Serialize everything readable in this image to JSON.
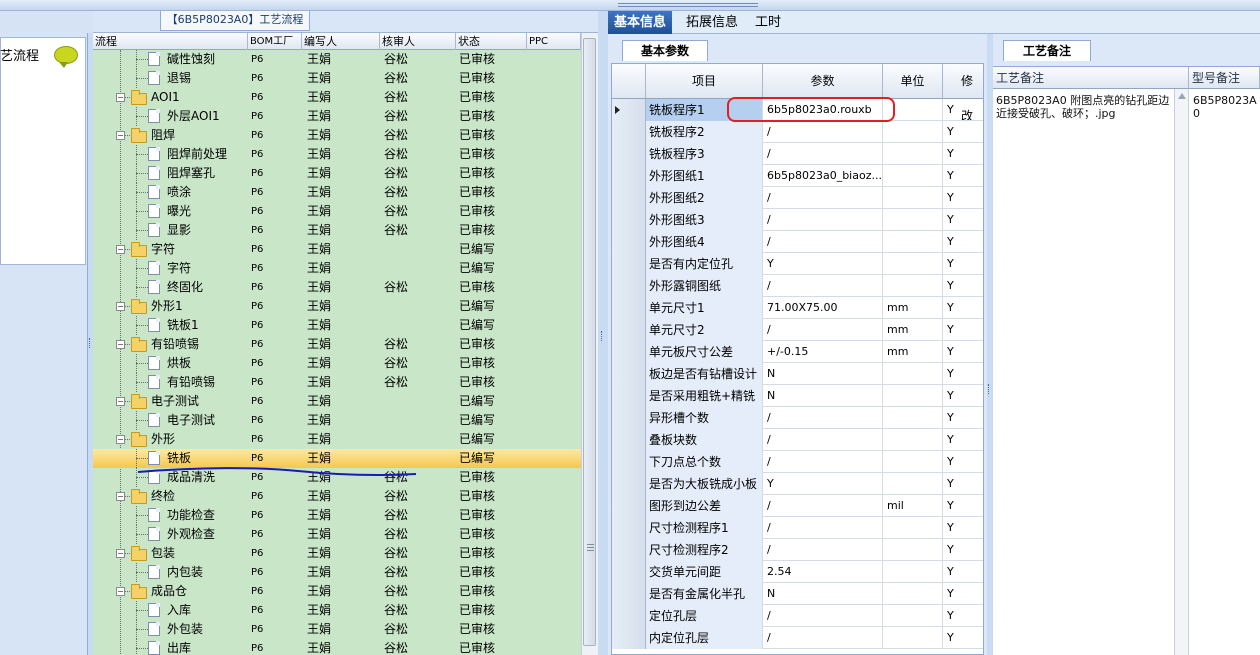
{
  "window": {
    "title_tab": "【6B5P8023A0】工艺流程"
  },
  "left_panel": {
    "flow_label": "艺流程"
  },
  "tree_grid": {
    "columns": [
      "流程",
      "BOM工厂",
      "编写人",
      "核审人",
      "状态",
      "PPC"
    ],
    "rows": [
      {
        "level": 1,
        "type": "doc",
        "name": "碱性蚀刻",
        "bom": "P6",
        "writer": "王娟",
        "reviewer": "谷松",
        "status": "已审核"
      },
      {
        "level": 1,
        "type": "doc",
        "name": "退锡",
        "bom": "P6",
        "writer": "王娟",
        "reviewer": "谷松",
        "status": "已审核"
      },
      {
        "level": 0,
        "type": "folder",
        "name": "AOI1",
        "bom": "P6",
        "writer": "王娟",
        "reviewer": "谷松",
        "status": "已审核"
      },
      {
        "level": 1,
        "type": "doc",
        "name": "外层AOI1",
        "bom": "P6",
        "writer": "王娟",
        "reviewer": "谷松",
        "status": "已审核"
      },
      {
        "level": 0,
        "type": "folder",
        "name": "阻焊",
        "bom": "P6",
        "writer": "王娟",
        "reviewer": "谷松",
        "status": "已审核"
      },
      {
        "level": 1,
        "type": "doc",
        "name": "阻焊前处理",
        "bom": "P6",
        "writer": "王娟",
        "reviewer": "谷松",
        "status": "已审核"
      },
      {
        "level": 1,
        "type": "doc",
        "name": "阻焊塞孔",
        "bom": "P6",
        "writer": "王娟",
        "reviewer": "谷松",
        "status": "已审核"
      },
      {
        "level": 1,
        "type": "doc",
        "name": "喷涂",
        "bom": "P6",
        "writer": "王娟",
        "reviewer": "谷松",
        "status": "已审核"
      },
      {
        "level": 1,
        "type": "doc",
        "name": "曝光",
        "bom": "P6",
        "writer": "王娟",
        "reviewer": "谷松",
        "status": "已审核"
      },
      {
        "level": 1,
        "type": "doc",
        "name": "显影",
        "bom": "P6",
        "writer": "王娟",
        "reviewer": "谷松",
        "status": "已审核"
      },
      {
        "level": 0,
        "type": "folder",
        "name": "字符",
        "bom": "P6",
        "writer": "王娟",
        "reviewer": "",
        "status": "已编写"
      },
      {
        "level": 1,
        "type": "doc",
        "name": "字符",
        "bom": "P6",
        "writer": "王娟",
        "reviewer": "",
        "status": "已编写"
      },
      {
        "level": 1,
        "type": "doc",
        "name": "终固化",
        "bom": "P6",
        "writer": "王娟",
        "reviewer": "谷松",
        "status": "已审核"
      },
      {
        "level": 0,
        "type": "folder",
        "name": "外形1",
        "bom": "P6",
        "writer": "王娟",
        "reviewer": "",
        "status": "已编写"
      },
      {
        "level": 1,
        "type": "doc",
        "name": "铣板1",
        "bom": "P6",
        "writer": "王娟",
        "reviewer": "",
        "status": "已编写"
      },
      {
        "level": 0,
        "type": "folder",
        "name": "有铅喷锡",
        "bom": "P6",
        "writer": "王娟",
        "reviewer": "谷松",
        "status": "已审核"
      },
      {
        "level": 1,
        "type": "doc",
        "name": "烘板",
        "bom": "P6",
        "writer": "王娟",
        "reviewer": "谷松",
        "status": "已审核"
      },
      {
        "level": 1,
        "type": "doc",
        "name": "有铅喷锡",
        "bom": "P6",
        "writer": "王娟",
        "reviewer": "谷松",
        "status": "已审核"
      },
      {
        "level": 0,
        "type": "folder",
        "name": "电子测试",
        "bom": "P6",
        "writer": "王娟",
        "reviewer": "",
        "status": "已编写"
      },
      {
        "level": 1,
        "type": "doc",
        "name": "电子测试",
        "bom": "P6",
        "writer": "王娟",
        "reviewer": "",
        "status": "已编写"
      },
      {
        "level": 0,
        "type": "folder",
        "name": "外形",
        "bom": "P6",
        "writer": "王娟",
        "reviewer": "",
        "status": "已编写"
      },
      {
        "level": 1,
        "type": "doc",
        "name": "铣板",
        "bom": "P6",
        "writer": "王娟",
        "reviewer": "",
        "status": "已编写",
        "selected": true
      },
      {
        "level": 1,
        "type": "doc",
        "name": "成品清洗",
        "bom": "P6",
        "writer": "王娟",
        "reviewer": "谷松",
        "status": "已审核"
      },
      {
        "level": 0,
        "type": "folder",
        "name": "终检",
        "bom": "P6",
        "writer": "王娟",
        "reviewer": "谷松",
        "status": "已审核"
      },
      {
        "level": 1,
        "type": "doc",
        "name": "功能检查",
        "bom": "P6",
        "writer": "王娟",
        "reviewer": "谷松",
        "status": "已审核"
      },
      {
        "level": 1,
        "type": "doc",
        "name": "外观检查",
        "bom": "P6",
        "writer": "王娟",
        "reviewer": "谷松",
        "status": "已审核"
      },
      {
        "level": 0,
        "type": "folder",
        "name": "包装",
        "bom": "P6",
        "writer": "王娟",
        "reviewer": "谷松",
        "status": "已审核"
      },
      {
        "level": 1,
        "type": "doc",
        "name": "内包装",
        "bom": "P6",
        "writer": "王娟",
        "reviewer": "谷松",
        "status": "已审核"
      },
      {
        "level": 0,
        "type": "folder",
        "name": "成品仓",
        "bom": "P6",
        "writer": "王娟",
        "reviewer": "谷松",
        "status": "已审核"
      },
      {
        "level": 1,
        "type": "doc",
        "name": "入库",
        "bom": "P6",
        "writer": "王娟",
        "reviewer": "谷松",
        "status": "已审核"
      },
      {
        "level": 1,
        "type": "doc",
        "name": "外包装",
        "bom": "P6",
        "writer": "王娟",
        "reviewer": "谷松",
        "status": "已审核"
      },
      {
        "level": 1,
        "type": "doc",
        "name": "出库",
        "bom": "P6",
        "writer": "王娟",
        "reviewer": "谷松",
        "status": "已审核"
      }
    ]
  },
  "right_tabs": [
    "基本信息",
    "拓展信息",
    "工时"
  ],
  "basic_params": {
    "tab_label": "基本参数",
    "columns": [
      "项目",
      "参数",
      "单位",
      "修改"
    ],
    "rows": [
      {
        "item": "铣板程序1",
        "value": "6b5p8023a0.rouxb",
        "unit": "",
        "mod": "Y",
        "current": true
      },
      {
        "item": "铣板程序2",
        "value": "/",
        "unit": "",
        "mod": "Y"
      },
      {
        "item": "铣板程序3",
        "value": "/",
        "unit": "",
        "mod": "Y"
      },
      {
        "item": "外形图纸1",
        "value": "6b5p8023a0_biaoz...",
        "unit": "",
        "mod": "Y"
      },
      {
        "item": "外形图纸2",
        "value": "/",
        "unit": "",
        "mod": "Y"
      },
      {
        "item": "外形图纸3",
        "value": "/",
        "unit": "",
        "mod": "Y"
      },
      {
        "item": "外形图纸4",
        "value": "/",
        "unit": "",
        "mod": "Y"
      },
      {
        "item": "是否有内定位孔",
        "value": "Y",
        "unit": "",
        "mod": "Y"
      },
      {
        "item": "外形露铜图纸",
        "value": "/",
        "unit": "",
        "mod": "Y"
      },
      {
        "item": "单元尺寸1",
        "value": "71.00X75.00",
        "unit": "mm",
        "mod": "Y"
      },
      {
        "item": "单元尺寸2",
        "value": "/",
        "unit": "mm",
        "mod": "Y"
      },
      {
        "item": "单元板尺寸公差",
        "value": "+/-0.15",
        "unit": "mm",
        "mod": "Y"
      },
      {
        "item": "板边是否有钻槽设计",
        "value": "N",
        "unit": "",
        "mod": "Y"
      },
      {
        "item": "是否采用粗铣+精铣",
        "value": "N",
        "unit": "",
        "mod": "Y"
      },
      {
        "item": "异形槽个数",
        "value": "/",
        "unit": "",
        "mod": "Y"
      },
      {
        "item": "叠板块数",
        "value": "/",
        "unit": "",
        "mod": "Y"
      },
      {
        "item": "下刀点总个数",
        "value": "/",
        "unit": "",
        "mod": "Y"
      },
      {
        "item": "是否为大板铣成小板",
        "value": "Y",
        "unit": "",
        "mod": "Y"
      },
      {
        "item": "图形到边公差",
        "value": "/",
        "unit": "mil",
        "mod": "Y"
      },
      {
        "item": "尺寸检测程序1",
        "value": "/",
        "unit": "",
        "mod": "Y"
      },
      {
        "item": "尺寸检测程序2",
        "value": "/",
        "unit": "",
        "mod": "Y"
      },
      {
        "item": "交货单元间距",
        "value": "2.54",
        "unit": "",
        "mod": "Y"
      },
      {
        "item": "是否有金属化半孔",
        "value": "N",
        "unit": "",
        "mod": "Y"
      },
      {
        "item": "定位孔层",
        "value": "/",
        "unit": "",
        "mod": "Y"
      },
      {
        "item": "内定位孔层",
        "value": "/",
        "unit": "",
        "mod": "Y"
      }
    ]
  },
  "process_notes": {
    "tab_label": "工艺备注",
    "columns": [
      "工艺备注",
      "型号备注"
    ],
    "note": "6B5P8023A0 附图点亮的钻孔距边近接受破孔、破环；.jpg",
    "model_note": "6B5P8023A0"
  },
  "colors": {
    "tree_bg": "#c9e6c9",
    "selected_row": "#f5c84d",
    "active_tab": "#2a5ead",
    "highlight_box": "#e02020",
    "annotation_line": "#1b1bb0"
  }
}
